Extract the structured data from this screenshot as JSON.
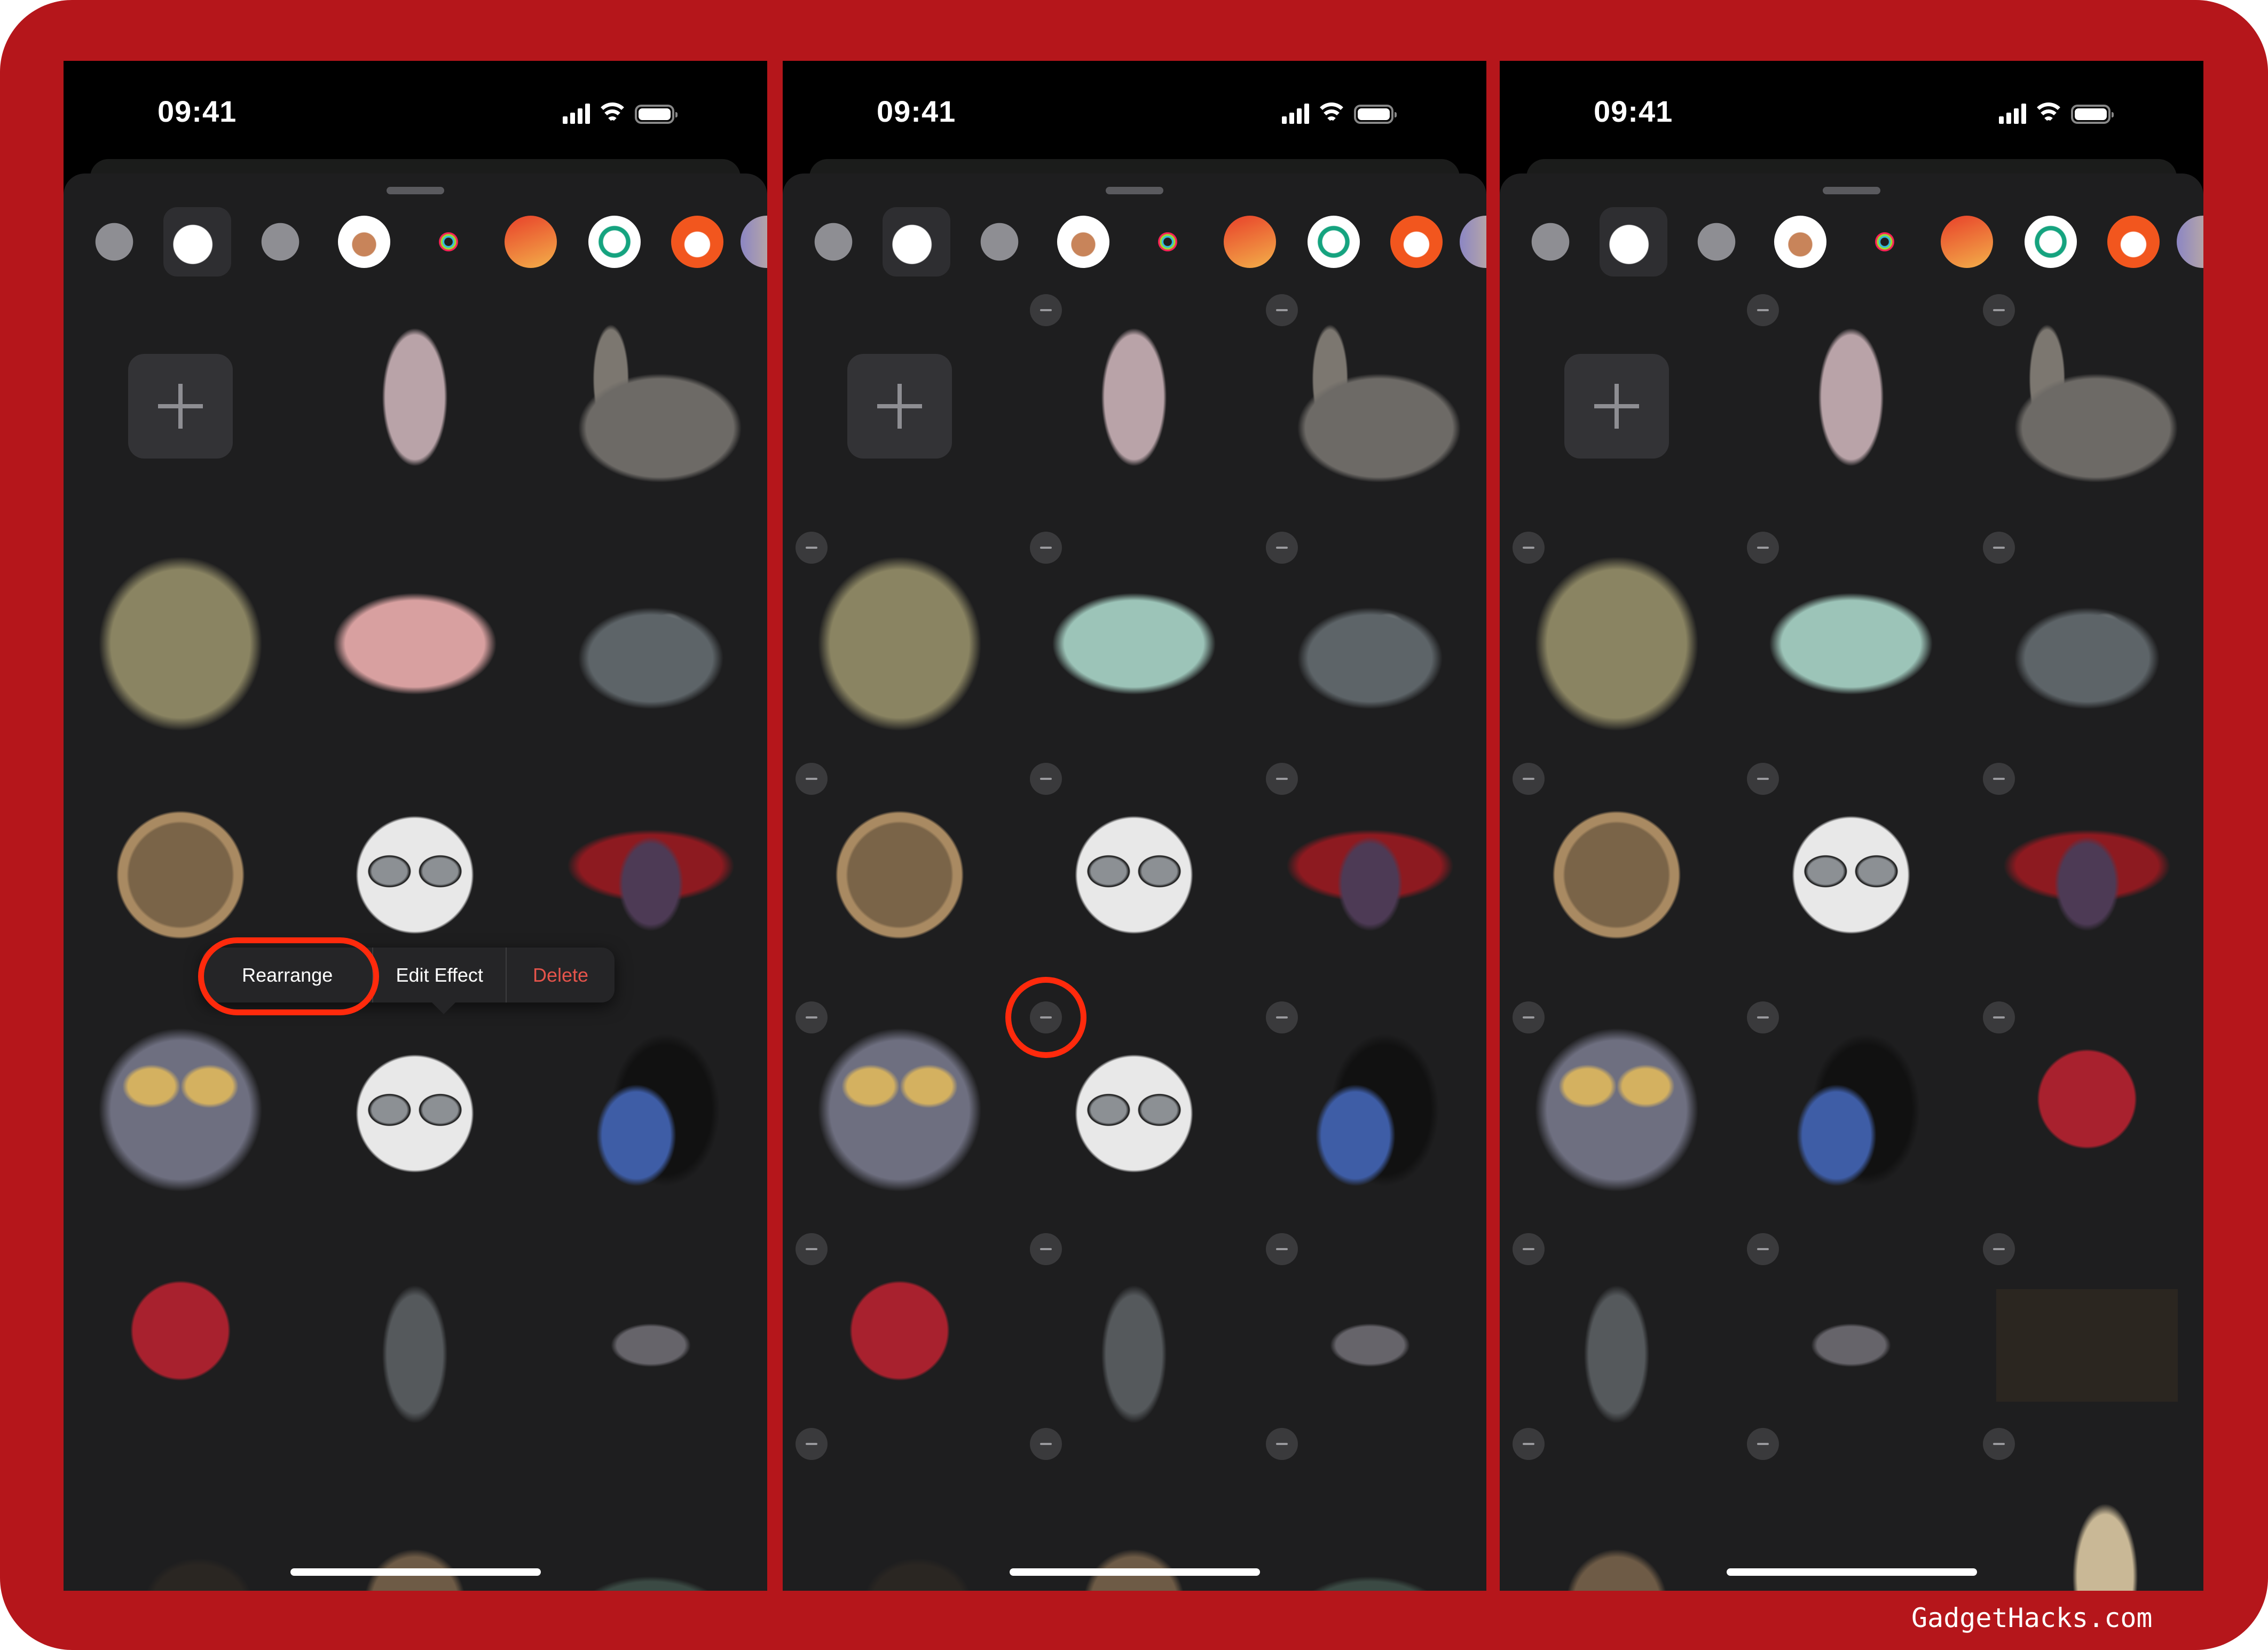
{
  "watermark": "GadgetHacks.com",
  "colors": {
    "frame": "#b5161b",
    "highlight_ring": "#ff2a0c",
    "delete_text": "#e5544b",
    "sheet": "#1e1e1f"
  },
  "categories": [
    "clock-icon",
    "stickers-icon",
    "emoji-icon",
    "memoji-icon",
    "activity-icon",
    "garageband-icon",
    "grammarly-icon",
    "reddit-icon",
    "more-app-icon"
  ],
  "panels": [
    {
      "time": "09:41",
      "selected_category": 1,
      "edit_mode": false,
      "menu": {
        "items": [
          "Rearrange",
          "Edit Effect",
          "Delete"
        ],
        "highlighted": 0
      },
      "stickers": [
        "add-sticker-button",
        "girl-sticker",
        "llama-sticker",
        "skull-sticker",
        "pink-butterfly-sticker",
        "penguin-sticker",
        "medallion-sticker",
        "memoji-glasses-sticker",
        "bat-sticker",
        "elephant-sticker",
        "memoji-glasses-sticker",
        "dog-sweater-sticker",
        "dahlia-sticker",
        "penguin-standing-sticker",
        "turkey-sticker",
        "black-cat-sticker",
        "brown-cat-sticker",
        "cat-partial-sticker"
      ]
    },
    {
      "time": "09:41",
      "selected_category": 1,
      "edit_mode": true,
      "highlighted_delete_index": 10,
      "stickers": [
        "add-sticker-button",
        "girl-sticker",
        "llama-sticker",
        "skull-sticker",
        "teal-butterfly-sticker",
        "penguin-sticker",
        "medallion-sticker",
        "memoji-glasses-sticker",
        "bat-sticker",
        "elephant-sticker",
        "memoji-glasses-sticker",
        "dog-sweater-sticker",
        "dahlia-sticker",
        "penguin-standing-sticker",
        "turkey-sticker",
        "black-cat-sticker",
        "brown-cat-sticker",
        "cat-partial-sticker"
      ]
    },
    {
      "time": "09:41",
      "selected_category": 1,
      "edit_mode": true,
      "stickers": [
        "add-sticker-button",
        "girl-sticker",
        "llama-sticker",
        "skull-sticker",
        "teal-butterfly-sticker",
        "penguin-sticker",
        "medallion-sticker",
        "memoji-glasses-sticker",
        "bat-sticker",
        "elephant-sticker",
        "dog-sweater-sticker",
        "dahlia-sticker",
        "penguin-standing-sticker",
        "turkey-sticker",
        "black-cat-box-sticker",
        "brown-cat-sticker",
        "empty",
        "giraffe-sticker"
      ]
    }
  ]
}
